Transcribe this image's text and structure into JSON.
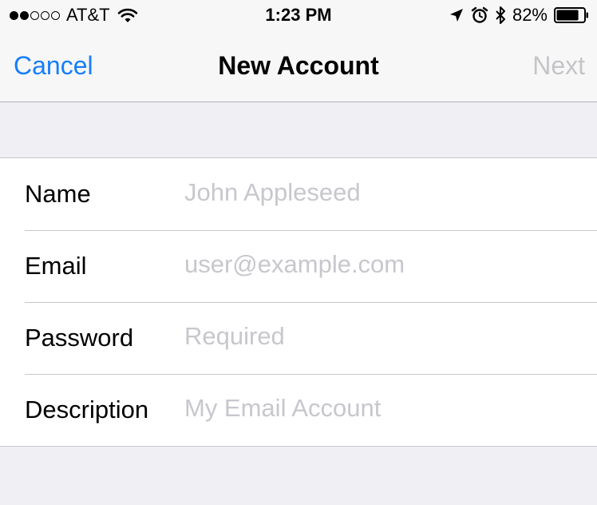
{
  "status_bar": {
    "carrier": "AT&T",
    "signal_bars_filled": 2,
    "signal_bars_total": 5,
    "time": "1:23 PM",
    "battery_percent": "82%",
    "battery_level": 0.82,
    "icons": [
      "wifi-icon",
      "location-arrow-icon",
      "alarm-clock-icon",
      "bluetooth-icon",
      "battery-icon"
    ]
  },
  "nav": {
    "cancel_label": "Cancel",
    "title": "New Account",
    "next_label": "Next",
    "accent_color": "#157efb",
    "disabled_color": "#c4c4c9"
  },
  "form": {
    "fields": [
      {
        "label": "Name",
        "value": "",
        "placeholder": "John Appleseed"
      },
      {
        "label": "Email",
        "value": "",
        "placeholder": "user@example.com"
      },
      {
        "label": "Password",
        "value": "",
        "placeholder": "Required"
      },
      {
        "label": "Description",
        "value": "",
        "placeholder": "My Email Account"
      }
    ]
  }
}
